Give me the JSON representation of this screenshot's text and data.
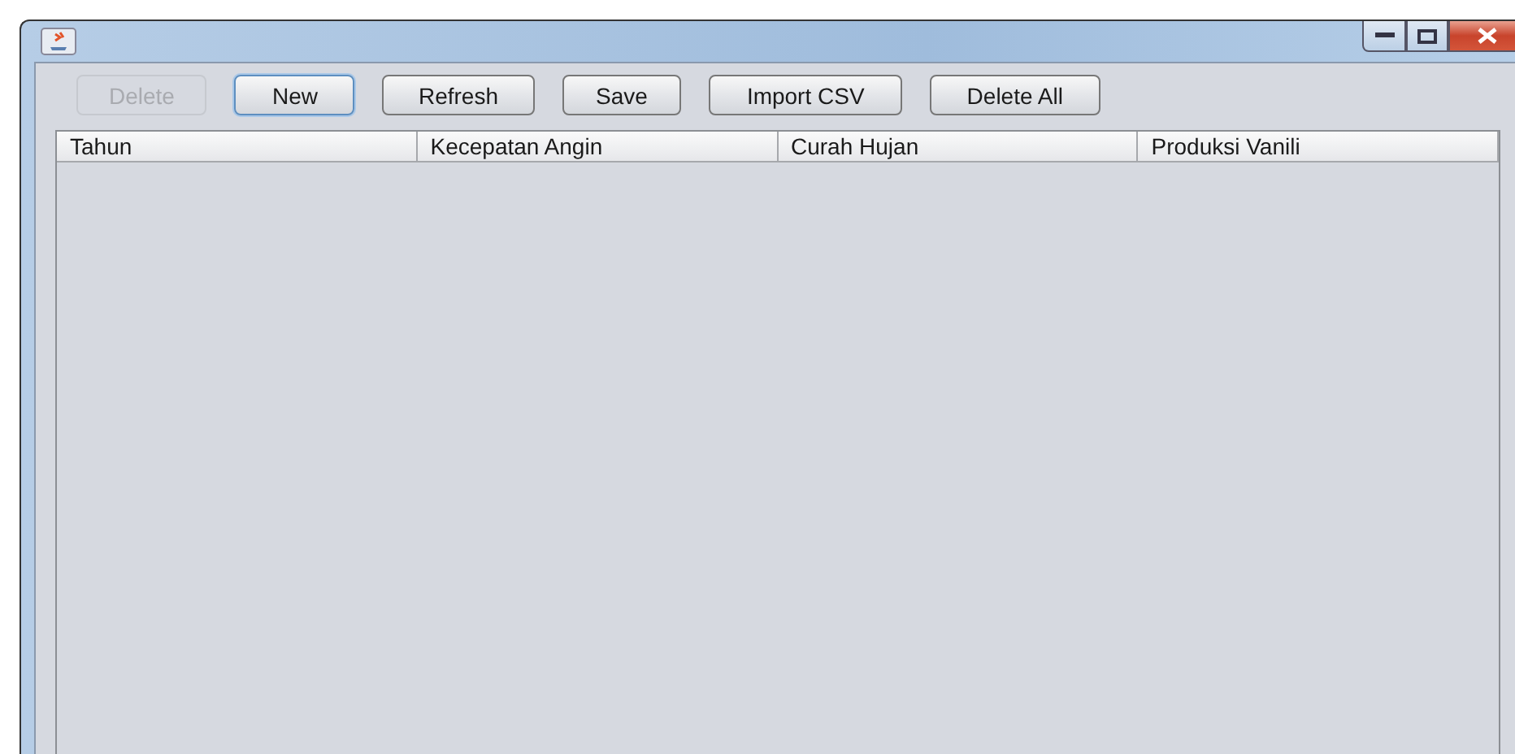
{
  "toolbar": {
    "buttons": [
      {
        "label": "Delete",
        "disabled": true,
        "focused": false
      },
      {
        "label": "New",
        "disabled": false,
        "focused": true
      },
      {
        "label": "Refresh",
        "disabled": false,
        "focused": false
      },
      {
        "label": "Save",
        "disabled": false,
        "focused": false
      },
      {
        "label": "Import CSV",
        "disabled": false,
        "focused": false
      },
      {
        "label": "Delete All",
        "disabled": false,
        "focused": false
      }
    ]
  },
  "table": {
    "columns": [
      "Tahun",
      "Kecepatan Angin",
      "Curah Hujan",
      "Produksi Vanili"
    ]
  }
}
